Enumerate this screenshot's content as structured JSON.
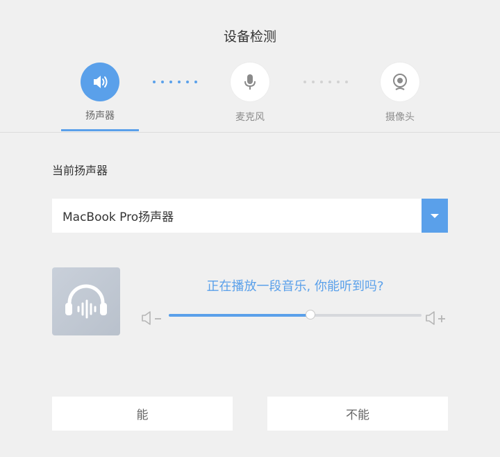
{
  "title": "设备检测",
  "steps": [
    {
      "label": "扬声器",
      "icon": "speaker-icon",
      "active": true
    },
    {
      "label": "麦克风",
      "icon": "microphone-icon",
      "active": false
    },
    {
      "label": "摄像头",
      "icon": "camera-icon",
      "active": false
    }
  ],
  "section_label": "当前扬声器",
  "speaker_select": {
    "value": "MacBook Pro扬声器"
  },
  "prompt": "正在播放一段音乐, 你能听到吗?",
  "volume": {
    "level": 0.56
  },
  "buttons": {
    "yes": "能",
    "no": "不能"
  },
  "colors": {
    "accent": "#5aa0ea",
    "background": "#f0f0f0"
  }
}
